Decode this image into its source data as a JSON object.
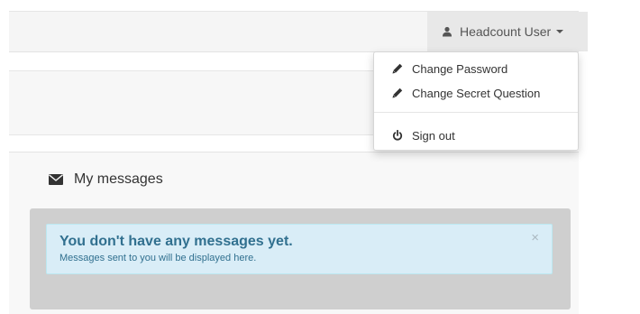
{
  "header": {
    "user_name": "Headcount User",
    "icons": {
      "user": "user-icon",
      "caret": "caret-down-icon"
    }
  },
  "user_menu": {
    "items": [
      {
        "label": "Change Password",
        "icon": "pencil-icon"
      },
      {
        "label": "Change Secret Question",
        "icon": "pencil-icon"
      },
      {
        "label": "Sign out",
        "icon": "power-icon"
      }
    ]
  },
  "messages_panel": {
    "title": "My messages",
    "title_icon": "envelope-icon",
    "alert": {
      "heading": "You don't have any messages yet.",
      "text": "Messages sent to you will be displayed here.",
      "close_symbol": "×"
    }
  },
  "colors": {
    "alert_bg": "#d9edf7",
    "alert_text": "#31708f",
    "well_bg": "#cfcfcf",
    "topbar_bg": "#f5f5f5"
  }
}
